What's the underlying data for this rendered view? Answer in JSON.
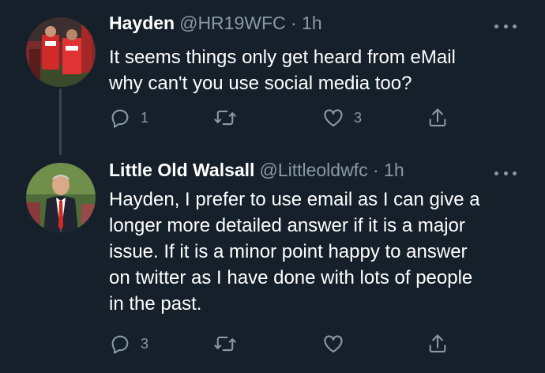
{
  "tweets": [
    {
      "name": "Hayden",
      "handle": "@HR19WFC",
      "dot": "·",
      "time": "1h",
      "text_lines": [
        "It seems things only get heard from eMail",
        "why can't you use social media too?"
      ],
      "replies": "1",
      "retweets": "",
      "likes": "3",
      "avatar": "football-players-photo"
    },
    {
      "name": "Little Old Walsall",
      "handle": "@Littleoldwfc",
      "dot": "·",
      "time": "1h",
      "text_lines": [
        "Hayden, I prefer to use email as I can give a",
        "longer more detailed answer if it is a major",
        "issue. If it is a minor point happy to answer",
        "on twitter as I have done with lots of people",
        "in the past."
      ],
      "replies": "3",
      "retweets": "",
      "likes": "",
      "avatar": "man-in-suit-photo"
    }
  ],
  "colors": {
    "background": "#15202b",
    "text": "#ffffff",
    "secondary": "#8b98a5",
    "thread_line": "#38444d"
  },
  "icons": [
    "reply-icon",
    "retweet-icon",
    "like-icon",
    "share-icon",
    "more-icon"
  ]
}
